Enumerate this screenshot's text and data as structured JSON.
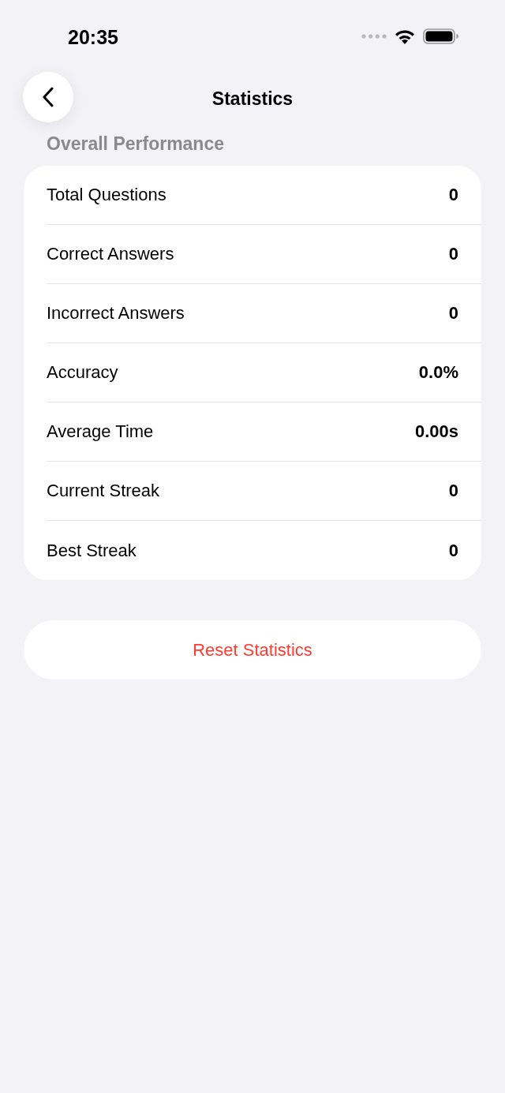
{
  "status_bar": {
    "time": "20:35"
  },
  "header": {
    "title": "Statistics"
  },
  "section": {
    "title": "Overall Performance"
  },
  "stats": [
    {
      "label": "Total Questions",
      "value": "0"
    },
    {
      "label": "Correct Answers",
      "value": "0"
    },
    {
      "label": "Incorrect Answers",
      "value": "0"
    },
    {
      "label": "Accuracy",
      "value": "0.0%"
    },
    {
      "label": "Average Time",
      "value": "0.00s"
    },
    {
      "label": "Current Streak",
      "value": "0"
    },
    {
      "label": "Best Streak",
      "value": "0"
    }
  ],
  "reset_button": {
    "label": "Reset Statistics"
  }
}
